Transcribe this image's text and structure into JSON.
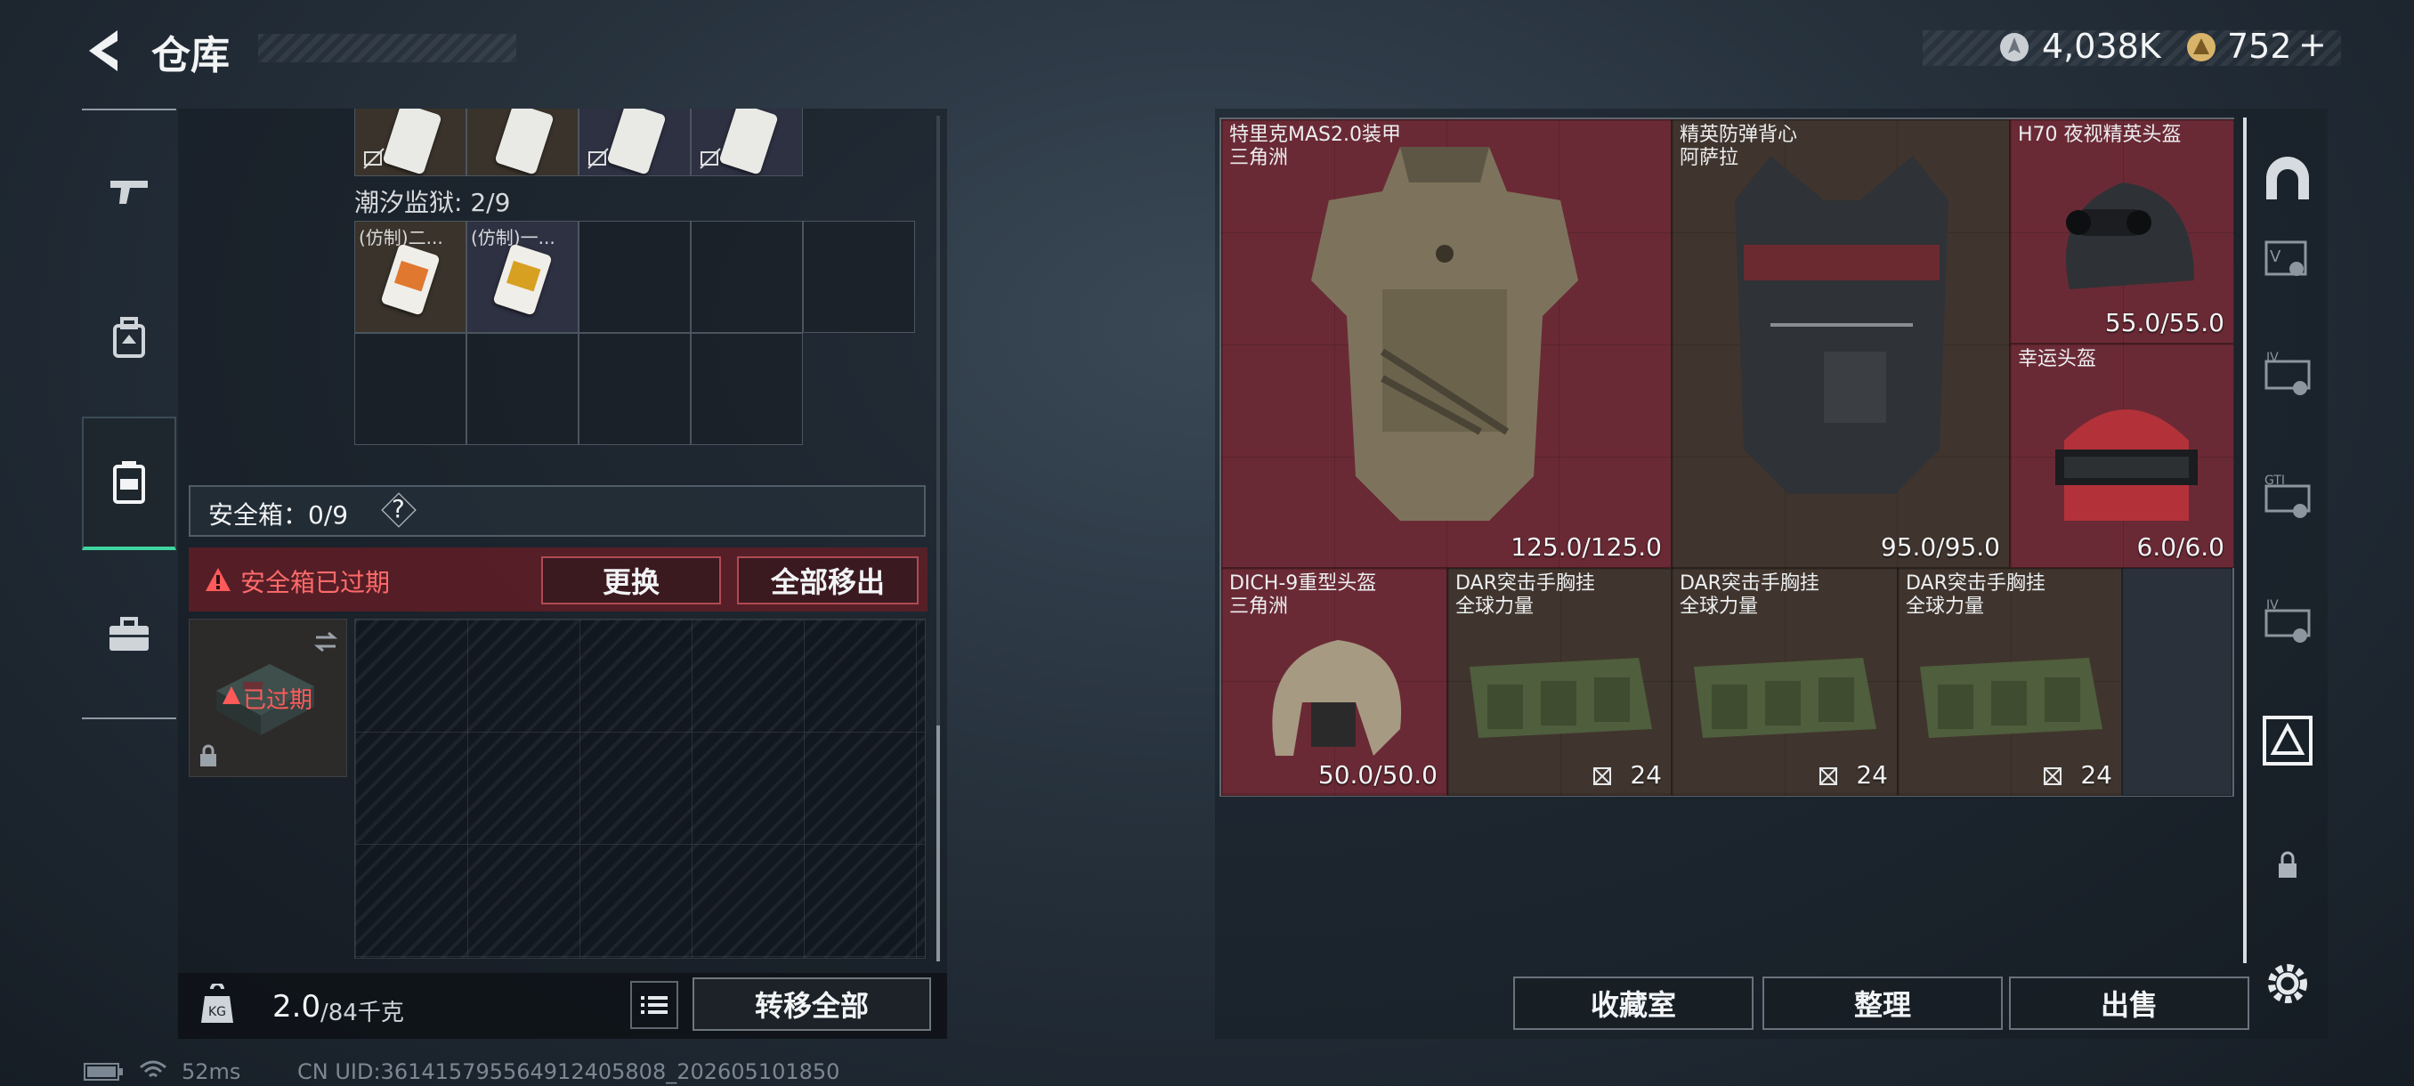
{
  "header": {
    "title": "仓库",
    "currency_silver": "4,038K",
    "currency_gold": "752",
    "plus": "+"
  },
  "left_nav": {
    "items": [
      "weapons-icon",
      "backpack-icon",
      "container-icon",
      "case-icon"
    ],
    "active": 2
  },
  "containers": {
    "tide_prison": {
      "title": "潮汐监狱: 2/9",
      "items": [
        "(仿制)二...",
        "(仿制)一..."
      ]
    },
    "safe_box": {
      "title": "安全箱：0/9",
      "help": "?",
      "warning": "安全箱已过期",
      "replace_label": "更换",
      "remove_all_label": "全部移出",
      "expired_label": "已过期"
    }
  },
  "bottom": {
    "weight": "2.0",
    "weight_max": "/84千克",
    "transfer_all_label": "转移全部"
  },
  "stash": {
    "items": [
      {
        "name": "特里克MAS2.0装甲",
        "sub": "三角洲",
        "value": "125.0/125.0"
      },
      {
        "name": "精英防弹背心",
        "sub": "阿萨拉",
        "value": "95.0/95.0"
      },
      {
        "name": "H70 夜视精英头盔",
        "sub": "",
        "value": "55.0/55.0"
      },
      {
        "name": "幸运头盔",
        "sub": "",
        "value": "6.0/6.0"
      },
      {
        "name": "DICH-9重型头盔",
        "sub": "三角洲",
        "value": "50.0/50.0"
      },
      {
        "name": "DAR突击手胸挂",
        "sub": "全球力量",
        "value": "24"
      },
      {
        "name": "DAR突击手胸挂",
        "sub": "全球力量",
        "value": "24"
      },
      {
        "name": "DAR突击手胸挂",
        "sub": "全球力量",
        "value": "24"
      }
    ],
    "actions": {
      "collection": "收藏室",
      "sort": "整理",
      "sell": "出售"
    }
  },
  "right_nav": {
    "tabs": [
      "helmet-tab-icon",
      "V",
      "IV",
      "GTI",
      "IV",
      "pyramid-icon",
      "lock-icon",
      "settings-icon"
    ]
  },
  "footer": {
    "ping": "52ms",
    "uid": "CN UID:361415795564912405808_202605101850"
  }
}
